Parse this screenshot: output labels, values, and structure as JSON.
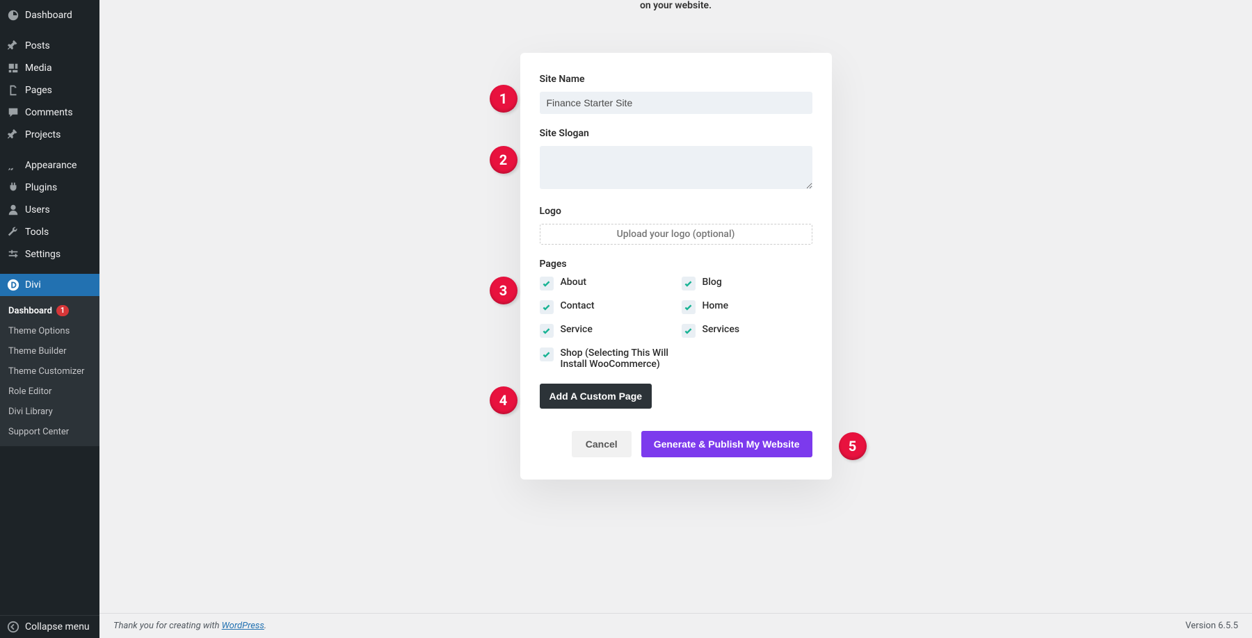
{
  "topHint": "on your website.",
  "sidebar": {
    "items": [
      {
        "label": "Dashboard"
      },
      {
        "label": "Posts"
      },
      {
        "label": "Media"
      },
      {
        "label": "Pages"
      },
      {
        "label": "Comments"
      },
      {
        "label": "Projects"
      },
      {
        "label": "Appearance"
      },
      {
        "label": "Plugins"
      },
      {
        "label": "Users"
      },
      {
        "label": "Tools"
      },
      {
        "label": "Settings"
      },
      {
        "label": "Divi"
      }
    ],
    "subitems": [
      {
        "label": "Dashboard",
        "badge": "1"
      },
      {
        "label": "Theme Options"
      },
      {
        "label": "Theme Builder"
      },
      {
        "label": "Theme Customizer"
      },
      {
        "label": "Role Editor"
      },
      {
        "label": "Divi Library"
      },
      {
        "label": "Support Center"
      }
    ],
    "collapse": "Collapse menu"
  },
  "form": {
    "siteName": {
      "label": "Site Name",
      "value": "Finance Starter Site"
    },
    "siteSlogan": {
      "label": "Site Slogan",
      "value": ""
    },
    "logo": {
      "label": "Logo",
      "placeholder": "Upload your logo (optional)"
    },
    "pages": {
      "label": "Pages",
      "options": [
        {
          "label": "About"
        },
        {
          "label": "Blog"
        },
        {
          "label": "Contact"
        },
        {
          "label": "Home"
        },
        {
          "label": "Service"
        },
        {
          "label": "Services"
        },
        {
          "label": "Shop (Selecting This Will Install WooCommerce)"
        }
      ]
    },
    "addCustom": "Add A Custom Page",
    "cancel": "Cancel",
    "generate": "Generate & Publish My Website"
  },
  "markers": [
    "1",
    "2",
    "3",
    "4",
    "5"
  ],
  "footer": {
    "prefix": "Thank you for creating with ",
    "link": "WordPress",
    "suffix": ".",
    "version": "Version 6.5.5"
  }
}
